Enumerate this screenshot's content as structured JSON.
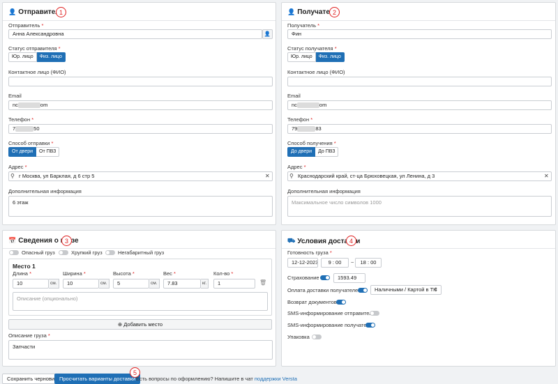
{
  "sender": {
    "title": "Отправитель",
    "badge": "1",
    "name_label": "Отправитель",
    "name_value": "Анна Александровна",
    "status_label": "Статус отправителя",
    "status_options": [
      "Юр. лицо",
      "Физ. лицо"
    ],
    "contact_label": "Контактное лицо (ФИО)",
    "email_label": "Email",
    "email_prefix": "nc",
    "email_suffix": "om",
    "phone_label": "Телефон",
    "phone_prefix": "7",
    "phone_suffix": "50",
    "method_label": "Способ отправки",
    "method_options": [
      "От двери",
      "От ПВЗ"
    ],
    "address_label": "Адрес",
    "address_value": "г Москва, ул Барклая, д 6 стр 5",
    "info_label": "Дополнительная информация",
    "info_value": "6 этаж"
  },
  "receiver": {
    "title": "Получатель",
    "badge": "2",
    "name_label": "Получатель",
    "name_value": "Фин",
    "status_label": "Статус получателя",
    "status_options": [
      "Юр. лицо",
      "Физ. лицо"
    ],
    "contact_label": "Контактное лицо (ФИО)",
    "email_label": "Email",
    "email_prefix": "nc",
    "email_suffix": "om",
    "phone_label": "Телефон",
    "phone_prefix": "79",
    "phone_suffix": "83",
    "method_label": "Способ получения",
    "method_options": [
      "До двери",
      "До ПВЗ"
    ],
    "address_label": "Адрес",
    "address_value": "Краснодарский край, ст-ца Брюховецкая, ул Ленина, д 3",
    "info_label": "Дополнительная информация",
    "info_placeholder": "Максимальное число символов 1000"
  },
  "cargo": {
    "title": "Сведения о грузе",
    "badge": "3",
    "toggles": [
      "Опасный груз",
      "Хрупкий груз",
      "Негабаритный груз"
    ],
    "place_title": "Место 1",
    "length_label": "Длина",
    "length_value": "10",
    "width_label": "Ширина",
    "width_value": "10",
    "height_label": "Высота",
    "height_value": "5",
    "weight_label": "Вес",
    "weight_value": "7.83",
    "qty_label": "Кол-во",
    "qty_value": "1",
    "unit_cm": "см.",
    "unit_kg": "кг.",
    "desc_placeholder": "Описание (опционально)",
    "add_place": "Добавить место",
    "cargo_desc_label": "Описание груза",
    "cargo_desc_value": "Запчасти"
  },
  "delivery": {
    "title": "Условия доставки",
    "badge": "4",
    "ready_label": "Готовность груза",
    "date": "12-12-2023",
    "time_from_h": "9",
    "time_from_m": "00",
    "time_to_h": "18",
    "time_to_m": "00",
    "insurance_label": "Страхование",
    "insurance_value": "1593.49",
    "payment_label": "Оплата доставки получателем",
    "payment_select": "Наличными / Картой в ТК",
    "docs_label": "Возврат документов",
    "sms_sender_label": "SMS-информирование отправителя",
    "sms_receiver_label": "SMS-информирование получателя",
    "packing_label": "Упаковка"
  },
  "footer": {
    "save_draft": "Сохранить черновик",
    "calc": "Просчитать варианты доставки",
    "badge": "5",
    "question_text": "Есть вопросы по оформлению? Напишите в чат",
    "support_link": "поддержки Versta"
  }
}
